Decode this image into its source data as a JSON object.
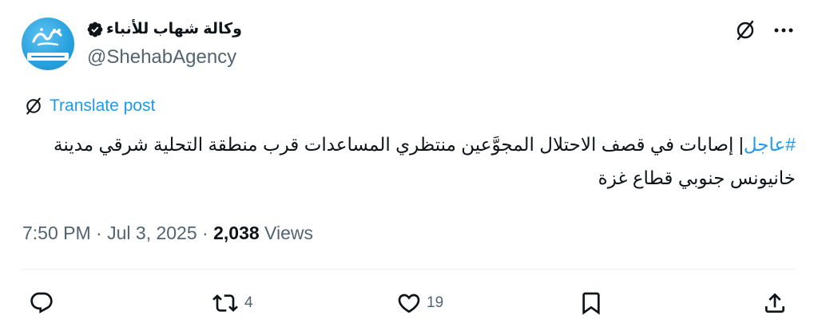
{
  "author": {
    "display_name": "وكالة شهاب للأنباء",
    "handle": "@ShehabAgency",
    "verified": true,
    "avatar": {
      "icon": "shehab-agency-logo-icon",
      "bg_color": "#2aa3e0"
    }
  },
  "header_actions": {
    "translate_icon": "translate-globe-icon",
    "more_icon": "more-options-icon"
  },
  "translate": {
    "label": "Translate post",
    "icon": "translate-globe-icon"
  },
  "post": {
    "hashtag": "#عاجل",
    "body": "| إصابات في قصف الاحتلال المجوَّعين منتظري المساعدات قرب منطقة التحلية شرقي مدينة خانيونس جنوبي قطاع غزة"
  },
  "meta": {
    "time": "7:50 PM",
    "separator_1": " · ",
    "date": "Jul 3, 2025",
    "separator_2": " · ",
    "views_count": "2,038",
    "views_label": " Views"
  },
  "actions": {
    "reply": {
      "icon": "reply-icon",
      "count": ""
    },
    "repost": {
      "icon": "repost-icon",
      "count": "4"
    },
    "like": {
      "icon": "like-heart-icon",
      "count": "19"
    },
    "bookmark": {
      "icon": "bookmark-icon",
      "count": ""
    },
    "share": {
      "icon": "share-icon",
      "count": ""
    }
  },
  "colors": {
    "text_primary": "#0f1419",
    "text_secondary": "#536471",
    "accent": "#1d9bf0",
    "divider": "#eff3f4"
  }
}
